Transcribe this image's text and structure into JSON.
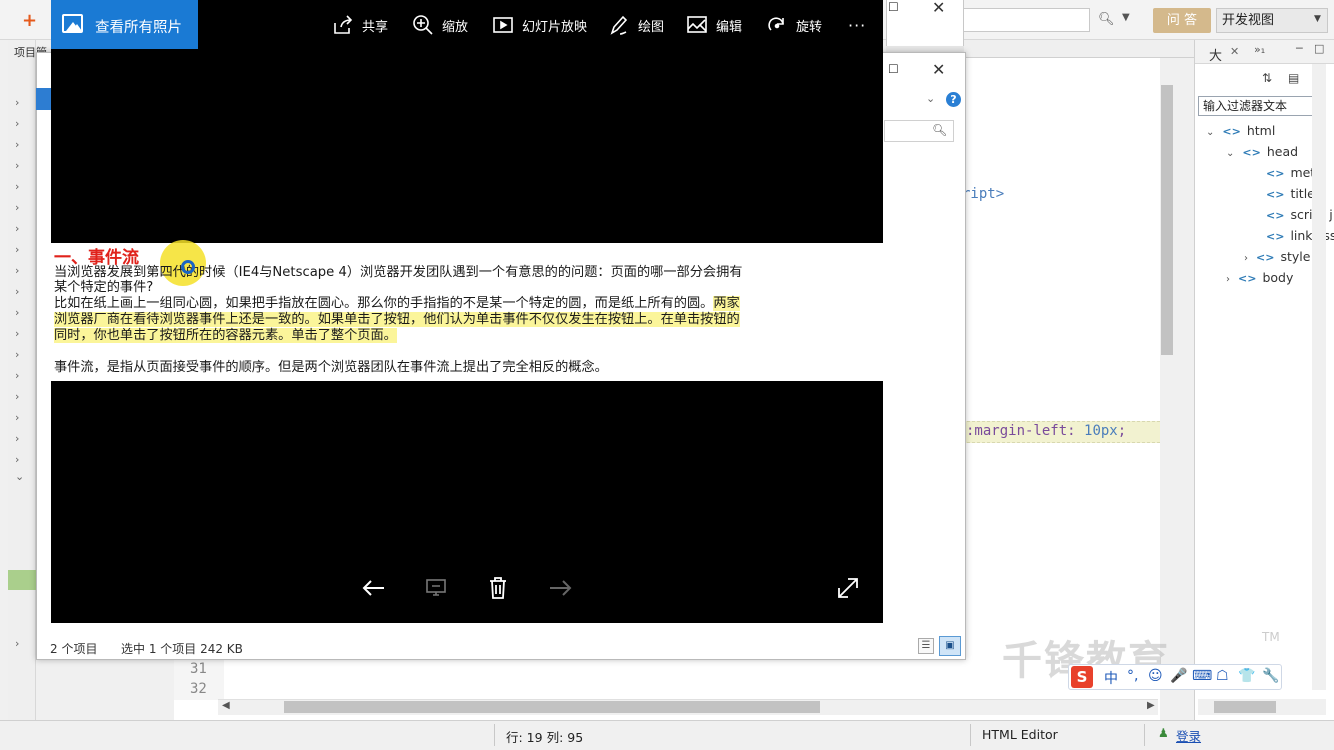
{
  "ide": {
    "plus": "+",
    "ask_button": "问 答",
    "perspective": "开发视图",
    "left_tab": "项目管",
    "code_fragment_1": "ript>",
    "code_fragment_2_prop": ":margin-left: ",
    "code_fragment_2_num": "10px",
    "code_fragment_2_end": ";",
    "line_numbers": [
      "31",
      "32"
    ],
    "outline": {
      "tab_label": "大",
      "tab2_label": "»₁",
      "filter_placeholder": "输入过滤器文本",
      "nodes": [
        {
          "label": "html",
          "arrow": "⌄"
        },
        {
          "label": "head",
          "arrow": "⌄"
        },
        {
          "label": "meta",
          "arrow": ""
        },
        {
          "label": "title",
          "arrow": ""
        },
        {
          "label": "script j",
          "arrow": ""
        },
        {
          "label": "link css",
          "arrow": ""
        },
        {
          "label": "style",
          "arrow": "›"
        },
        {
          "label": "body",
          "arrow": "›"
        }
      ]
    },
    "status": {
      "position": "行: 19 列: 95",
      "editor_type": "HTML Editor",
      "login": "登录"
    }
  },
  "watermark": {
    "text": "千锋教育",
    "tm": "TM"
  },
  "ime": {
    "logo": "S",
    "items": [
      "中",
      "°,",
      "☺",
      "🎤",
      "⌨",
      "☖",
      "👕",
      "🔧"
    ]
  },
  "explorer": {
    "item_count": "2 个项目",
    "selection": "选中 1 个项目  242 KB"
  },
  "viewer": {
    "home_label": "查看所有照片",
    "toolbar": [
      {
        "name": "share",
        "label": "共享"
      },
      {
        "name": "zoom",
        "label": "缩放"
      },
      {
        "name": "slideshow",
        "label": "幻灯片放映"
      },
      {
        "name": "draw",
        "label": "绘图"
      },
      {
        "name": "edit",
        "label": "编辑"
      },
      {
        "name": "rotate",
        "label": "旋转"
      }
    ],
    "more": "···"
  },
  "document": {
    "title": "一、事件流",
    "lines": [
      "当浏览器发展到第四代的时候（IE4与Netscape 4）浏览器开发团队遇到一个有意思的的问题：页面的哪一部分会拥有",
      "某个特定的事件?",
      "比如在纸上画上一组同心圆，如果把手指放在圆心。那么你的手指指的不是某一个特定的圆，而是纸上所有的圆。",
      "两家",
      "浏览器厂商在看待浏览器事件上还是一致的。如果单击了按钮，他们认为单击事件不仅仅发生在按钮上。在单击按钮的",
      "同时，你也单击了按钮所在的容器元素。单击了整个页面。",
      "事件流，是指从页面接受事件的顺序。但是两个浏览器团队在事件流上提出了完全相反的概念。"
    ]
  },
  "colors": {
    "viewer_accent": "#1a7ad4",
    "title_red": "#e0221b",
    "highlight": "#fbf59a",
    "ask_button": "#d4b98c"
  }
}
